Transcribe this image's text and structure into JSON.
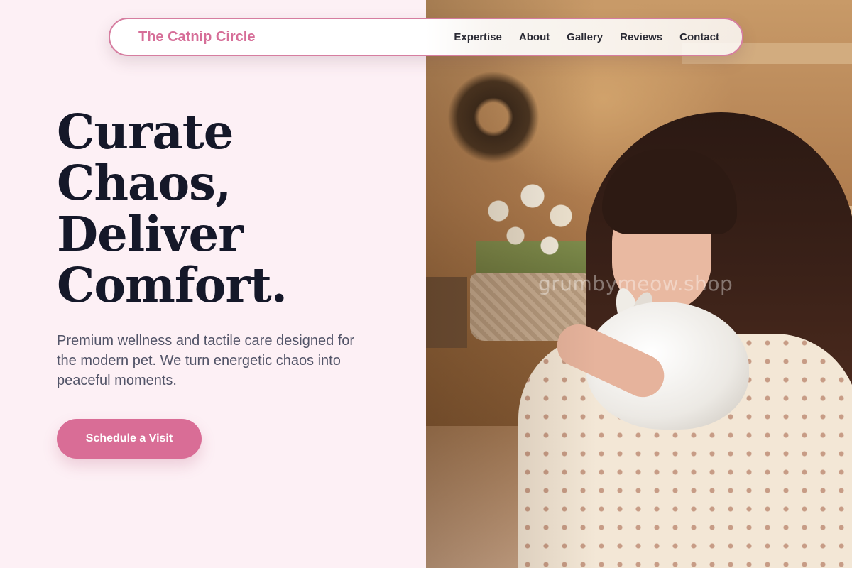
{
  "nav": {
    "brand": "The Catnip Circle",
    "links": [
      "Expertise",
      "About",
      "Gallery",
      "Reviews",
      "Contact"
    ]
  },
  "hero": {
    "title_lines": [
      "Curate",
      "Chaos,",
      "Deliver",
      "Comfort."
    ],
    "subtitle": "Premium wellness and tactile care designed for the modern pet. We turn energetic chaos into peaceful moments.",
    "cta_label": "Schedule a Visit"
  },
  "photo": {
    "watermark": "grumbymeow.shop"
  },
  "colors": {
    "accent": "#d96d96",
    "background": "#fdf0f5",
    "heading": "#151829",
    "body_text": "#525468"
  },
  "icons": []
}
